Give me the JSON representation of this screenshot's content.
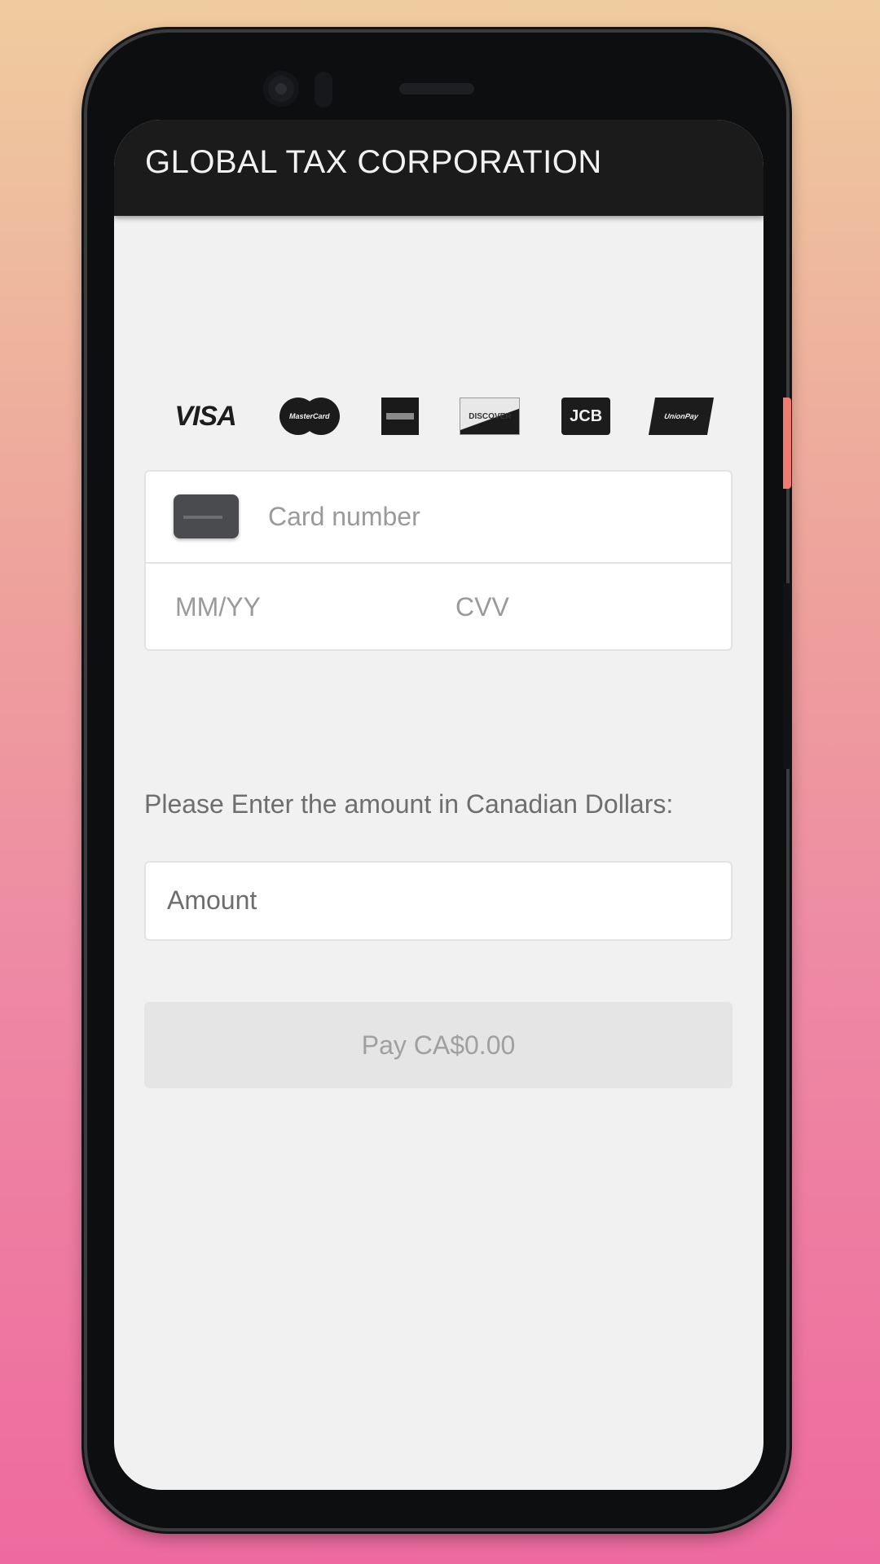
{
  "app": {
    "title": "GLOBAL TAX CORPORATION"
  },
  "card_brands": [
    {
      "name": "visa-icon",
      "label": "VISA"
    },
    {
      "name": "mastercard-icon",
      "label": "MasterCard"
    },
    {
      "name": "amex-icon",
      "label": ""
    },
    {
      "name": "discover-icon",
      "label": "DISCOVER"
    },
    {
      "name": "jcb-icon",
      "label": "JCB"
    },
    {
      "name": "unionpay-icon",
      "label": "UnionPay"
    }
  ],
  "card_form": {
    "card_number_placeholder": "Card number",
    "expiry_placeholder": "MM/YY",
    "cvv_placeholder": "CVV"
  },
  "amount": {
    "label": "Please Enter the amount in Canadian Dollars:",
    "placeholder": "Amount"
  },
  "pay_button": {
    "label": "Pay CA$0.00"
  },
  "colors": {
    "appbar": "#1b1b1b",
    "screen_bg": "#f1f1f1",
    "button_disabled": "#e5e5e5"
  }
}
